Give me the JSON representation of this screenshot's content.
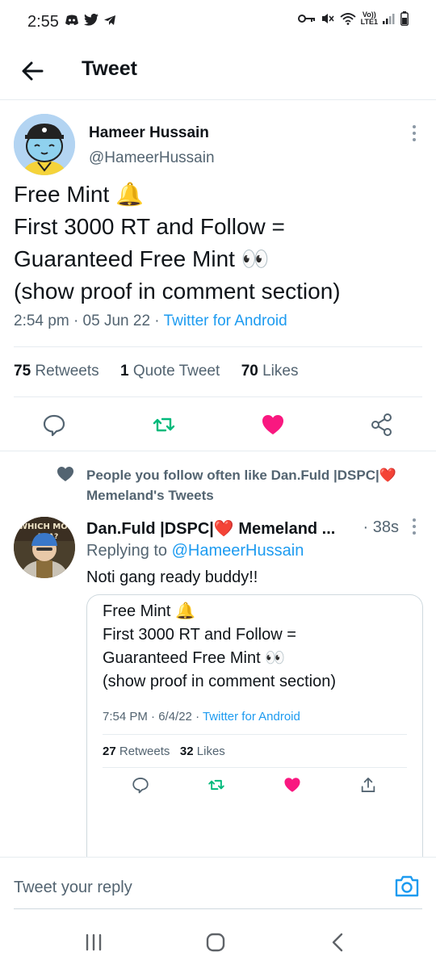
{
  "status": {
    "time": "2:55",
    "volte_label": "Vo))",
    "lte_label": "LTE1"
  },
  "appbar": {
    "title": "Tweet"
  },
  "tweet": {
    "author_name": "Hameer Hussain",
    "author_handle": "@HameerHussain",
    "text_lines": [
      "Free Mint 🔔",
      "First 3000 RT and Follow  =",
      "Guaranteed Free Mint 👀",
      "(show proof in comment section)"
    ],
    "time": "2:54 pm",
    "date": "05 Jun 22",
    "source": "Twitter for Android",
    "retweets_count": "75",
    "retweets_label": "Retweets",
    "quotes_count": "1",
    "quotes_label": "Quote Tweet",
    "likes_count": "70",
    "likes_label": "Likes"
  },
  "reply": {
    "social_context": "People you follow often like Dan.Fuld |DSPC|❤️ Memeland's Tweets",
    "author_name": "Dan.Fuld |DSPC|❤️ Memeland ...",
    "time": "· 38s",
    "replying_prefix": "Replying to",
    "replying_handle": "@HameerHussain",
    "text": "Noti gang ready buddy!!",
    "quote": {
      "text_lines": [
        "Free Mint 🔔",
        "First 3000 RT and Follow  =",
        "Guaranteed Free Mint 👀",
        "(show proof in comment section)"
      ],
      "time": "7:54 PM · 6/4/22 ·",
      "source": "Twitter for Android",
      "retweets_count": "27",
      "retweets_label": "Retweets",
      "likes_count": "32",
      "likes_label": "Likes"
    }
  },
  "composer": {
    "placeholder": "Tweet your reply"
  },
  "colors": {
    "accent": "#1d9bf0",
    "retweet_green": "#00ba7c",
    "like_pink": "#f91880",
    "secondary_text": "#536471"
  },
  "icons": {
    "back": "arrow-left-icon",
    "more": "more-vertical-icon",
    "reply": "comment-icon",
    "retweet": "retweet-icon",
    "like": "heart-filled-icon",
    "share": "share-icon",
    "camera": "camera-icon"
  }
}
